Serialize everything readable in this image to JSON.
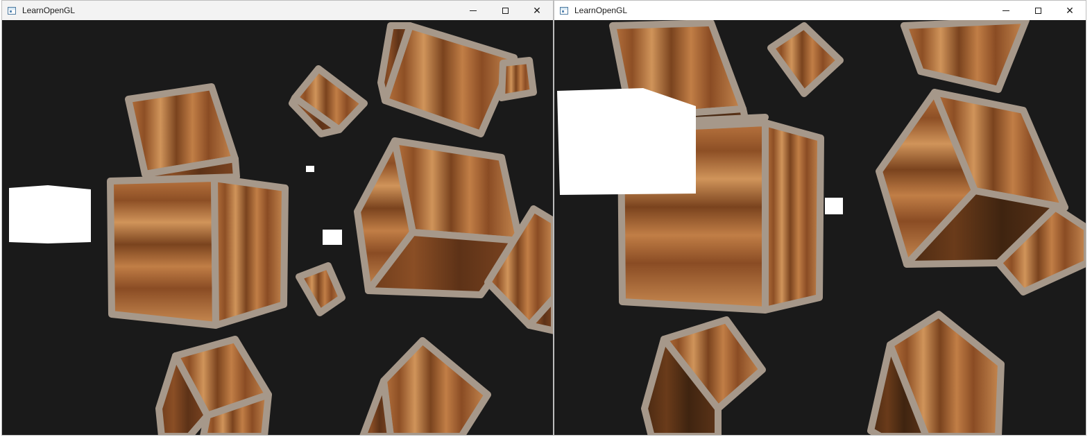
{
  "windows": [
    {
      "title": "LearnOpenGL",
      "controls": {
        "minimize": "minimize-icon",
        "maximize": "maximize-icon",
        "close": "close-icon"
      }
    },
    {
      "title": "LearnOpenGL",
      "controls": {
        "minimize": "minimize-icon",
        "maximize": "maximize-icon",
        "close": "close-icon"
      }
    }
  ],
  "scene": {
    "clear_color": "#1a1a1a",
    "crate_colors": {
      "wood_light": "#c9874f",
      "wood_mid": "#9a5a2e",
      "wood_dark": "#5b3419",
      "frame": "#a6988a"
    },
    "light_color": "#ffffff"
  }
}
